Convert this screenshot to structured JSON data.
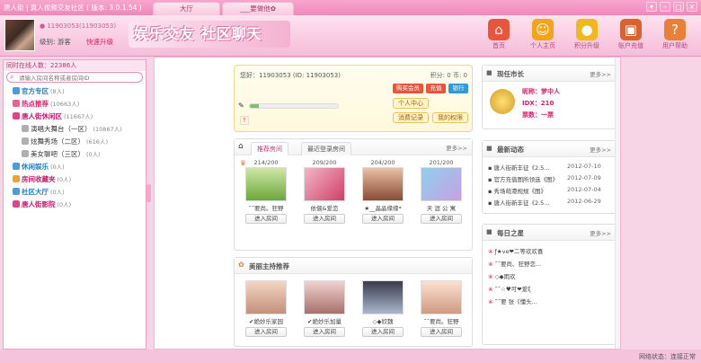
{
  "window": {
    "title": "唐人街 | 真人视频交友社区 ( 版本: 3.0.1.54 )",
    "tabs": [
      "大厅",
      "___要做他✿"
    ]
  },
  "header": {
    "user_id": "11903053(11903053)",
    "level_label": "级别: 游客",
    "upgrade_label": "快速升级",
    "banner": "娱乐交友 社区聊天",
    "nav": [
      {
        "label": "首页",
        "icon": "home-icon",
        "color": "#e8553d"
      },
      {
        "label": "个人主页",
        "icon": "person-icon",
        "color": "#f2a41c"
      },
      {
        "label": "积分升级",
        "icon": "coins-icon",
        "color": "#f0b81c"
      },
      {
        "label": "账户充值",
        "icon": "wallet-icon",
        "color": "#d9622f"
      },
      {
        "label": "用户帮助",
        "icon": "help-icon",
        "color": "#e8803a"
      }
    ]
  },
  "sidebar": {
    "online": "同时在线人数：22386人",
    "search_placeholder": "请输入房间名称或者房间ID",
    "items": [
      {
        "label": "官方专区",
        "count": "(8人)",
        "color": "#1a7bd4",
        "icon": "#4c9be0",
        "level": 0
      },
      {
        "label": "热点推荐",
        "count": "(10663人)",
        "color": "#e0206a",
        "icon": "#f0608c",
        "level": 0
      },
      {
        "label": "唐人街休闲区",
        "count": "(11667人)",
        "color": "#c8186a",
        "icon": "#e04488",
        "level": 0
      },
      {
        "label": "演唱大舞台（一区）",
        "count": "(10867人)",
        "color": "#333",
        "icon": "#b0b0b0",
        "level": 1
      },
      {
        "label": "炫舞秀场（二区）",
        "count": "(616人)",
        "color": "#333",
        "icon": "#b0b0b0",
        "level": 1
      },
      {
        "label": "美女聊吧（三区）",
        "count": "(0人)",
        "color": "#333",
        "icon": "#b0b0b0",
        "level": 1
      },
      {
        "label": "休闲娱乐",
        "count": "(0人)",
        "color": "#1a7bd4",
        "icon": "#4c9be0",
        "level": 0
      },
      {
        "label": "房间收藏夹",
        "count": "(0人)",
        "color": "#c8186a",
        "icon": "#e8a53a",
        "level": 0
      },
      {
        "label": "社区大厅",
        "count": "(0人)",
        "color": "#1a7bd4",
        "icon": "#4c9be0",
        "level": 0
      },
      {
        "label": "唐人街影院",
        "count": "(0人)",
        "color": "#c8186a",
        "icon": "#e04488",
        "level": 0
      }
    ]
  },
  "user_card": {
    "hello": "您好：11903053 (ID: 11903053)",
    "points": "积分: 0  币: 0",
    "actions": [
      "购买会员",
      "充值",
      "银行"
    ],
    "links": [
      "个人中心",
      "消费记录",
      "我的权限"
    ],
    "progress": 0.1
  },
  "rooms_panel": {
    "tabs": [
      "推荐房间",
      "最近登录房间"
    ],
    "more": "更多>>",
    "rooms": [
      {
        "count": "214/200",
        "name": "˜˜要尚。狂野",
        "thumb": "linear-gradient(#cfe6a8,#6aa83a)"
      },
      {
        "count": "209/200",
        "name": "依偎&爱恋",
        "thumb": "linear-gradient(135deg,#f2b6c9,#d04068)"
      },
      {
        "count": "204/200",
        "name": "★__晶晶缘缘*",
        "thumb": "linear-gradient(#e8c1a2,#8a4a36)"
      },
      {
        "count": "201/200",
        "name": "天 涯 公 寓",
        "thumb": "linear-gradient(135deg,#8ed0f0,#c8a0e0)"
      }
    ],
    "enter_label": "进入房间"
  },
  "hosts_panel": {
    "title": "美丽主持推荐",
    "rooms": [
      {
        "name": "✔絶妙乐家园",
        "thumb": "linear-gradient(#f2d6c4,#c49078)"
      },
      {
        "name": "✔絶妙乐加量",
        "thumb": "linear-gradient(#f0d2d0,#a8706a)"
      },
      {
        "name": "◇◆欣魏",
        "thumb": "linear-gradient(#3a3a4a,#a8b8d0)"
      },
      {
        "name": "˜˜要尚。狂野",
        "thumb": "linear-gradient(#fbe0d0,#d09a80)"
      }
    ],
    "enter_label": "进入房间"
  },
  "mayor_panel": {
    "title": "现任市长",
    "more": "更多>>",
    "nickname": "昵称：梦中人",
    "idx": "IDX：210",
    "votes": "票数：一票"
  },
  "news_panel": {
    "title": "最新动态",
    "more": "更多>>",
    "items": [
      {
        "text": "唐人街新丰征《2.5...",
        "date": "2012-07-10"
      },
      {
        "text": "官方充值图所领选《图》",
        "date": "2012-07-09"
      },
      {
        "text": "秀场萌港规规《图》",
        "date": "2012-07-04"
      },
      {
        "text": "唐人街新丰征《2.5...",
        "date": "2012-06-29"
      }
    ]
  },
  "stars_panel": {
    "title": "每日之星",
    "more": "更多>>",
    "items": [
      "ƒ★ve❤二等欢欢喜",
      "˜˜要尚、狂野恋...",
      "◇◆雨欢",
      "˜˜☆♥可❤爱ξ",
      "˜˜要 张《懂头..."
    ]
  },
  "status": {
    "text": "网络状态：连接正常"
  }
}
